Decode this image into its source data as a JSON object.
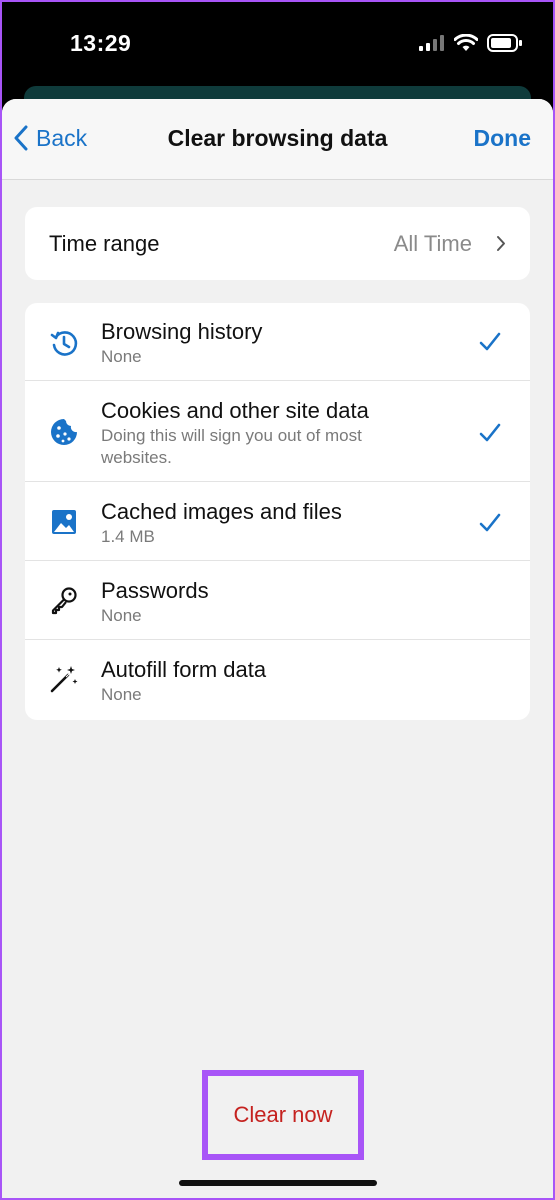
{
  "status_bar": {
    "time": "13:29"
  },
  "navbar": {
    "back_label": "Back",
    "title": "Clear browsing data",
    "done_label": "Done"
  },
  "time_range": {
    "label": "Time range",
    "value": "All Time"
  },
  "items": [
    {
      "title": "Browsing history",
      "subtitle": "None",
      "checked": true,
      "icon": "history-icon"
    },
    {
      "title": "Cookies and other site data",
      "subtitle": "Doing this will sign you out of most websites.",
      "checked": true,
      "icon": "cookie-icon"
    },
    {
      "title": "Cached images and files",
      "subtitle": "1.4 MB",
      "checked": true,
      "icon": "image-icon"
    },
    {
      "title": "Passwords",
      "subtitle": "None",
      "checked": false,
      "icon": "key-icon"
    },
    {
      "title": "Autofill form data",
      "subtitle": "None",
      "checked": false,
      "icon": "magic-wand-icon"
    }
  ],
  "actions": {
    "clear_now_label": "Clear now"
  },
  "colors": {
    "accent": "#1a73c8",
    "destructive": "#c5221f",
    "highlight": "#a855f7"
  }
}
